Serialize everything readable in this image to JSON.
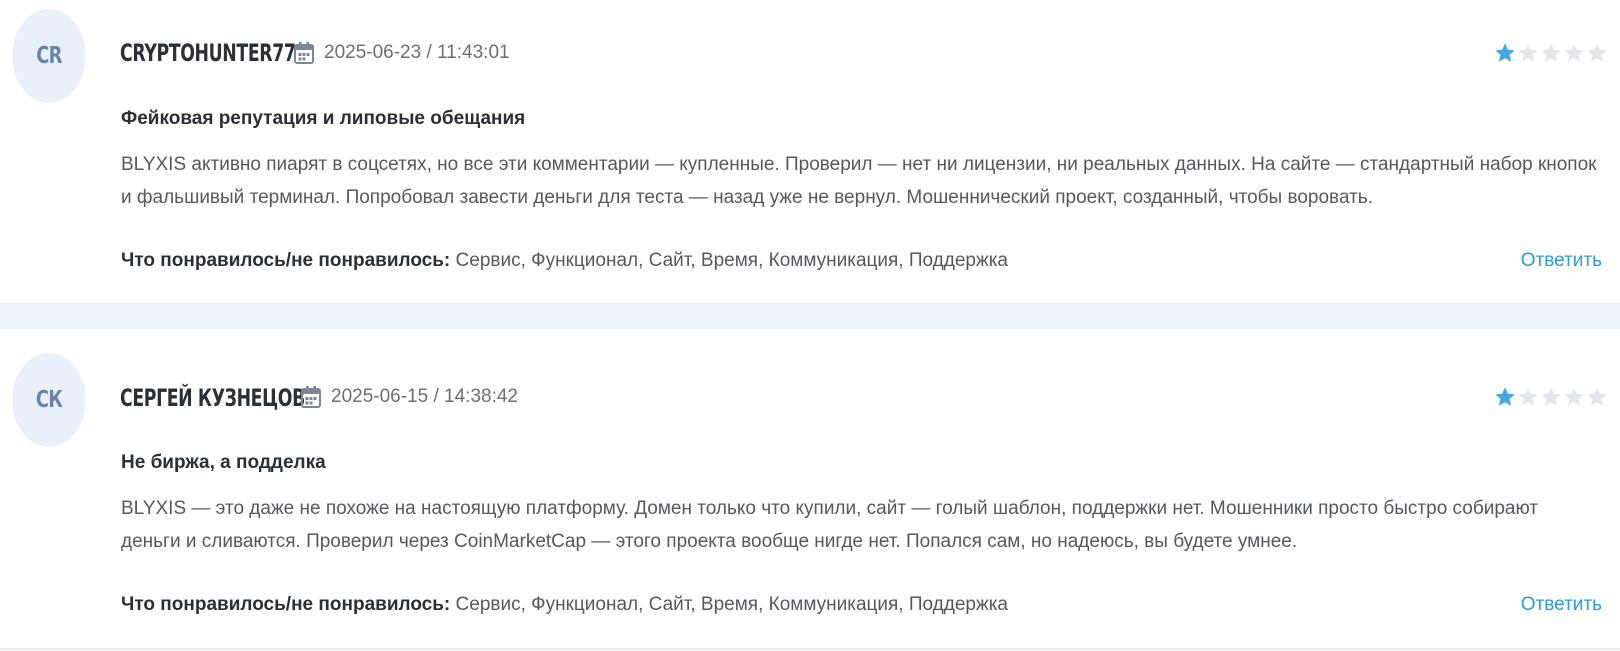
{
  "colors": {
    "accent": "#2e9ad8",
    "star_filled": "#3fa9e6",
    "star_empty": "#e3e6ea",
    "avatar_bg": "#e8f1fa",
    "avatar_text": "#6a84a6",
    "separator": "#eef4f9"
  },
  "icons": {
    "date": "calendar-icon",
    "rating": "star-icon"
  },
  "reviews": [
    {
      "initials": "CR",
      "author": "CRYPTOHUNTER77",
      "date": "2025-06-23 / 11:43:01",
      "rating": 1,
      "rating_max": 5,
      "title": "Фейковая репутация и липовые обещания",
      "text": "BLYXIS активно пиарят в соцсетях, но все эти комментарии — купленные. Проверил — нет ни лицензии, ни реальных данных. На сайте — стандартный набор кнопок и фальшивый терминал. Попробовал завести деньги для теста — назад уже не вернул. Мошеннический проект, созданный, чтобы воровать.",
      "likes_label": "Что понравилось/не понравилось:",
      "likes_value": "Сервис, Функционал, Сайт, Время, Коммуникация, Поддержка",
      "reply_label": "Ответить"
    },
    {
      "initials": "СК",
      "author": "СЕРГЕЙ КУЗНЕЦОВ",
      "date": "2025-06-15 / 14:38:42",
      "rating": 1,
      "rating_max": 5,
      "title": "Не биржа, а подделка",
      "text": "BLYXIS — это даже не похоже на настоящую платформу. Домен только что купили, сайт — голый шаблон, поддержки нет. Мошенники просто быстро собирают деньги и сливаются. Проверил через CoinMarketCap — этого проекта вообще нигде нет. Попался сам, но надеюсь, вы будете умнее.",
      "likes_label": "Что понравилось/не понравилось:",
      "likes_value": "Сервис, Функционал, Сайт, Время, Коммуникация, Поддержка",
      "reply_label": "Ответить"
    }
  ]
}
